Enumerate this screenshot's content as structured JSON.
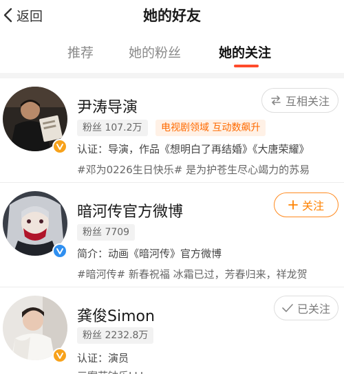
{
  "header": {
    "back_label": "返回",
    "title": "她的好友"
  },
  "tabs": [
    {
      "label": "推荐",
      "active": false
    },
    {
      "label": "她的粉丝",
      "active": false
    },
    {
      "label": "她的关注",
      "active": true
    }
  ],
  "colors": {
    "accent": "#ff4b2b",
    "follow_orange": "#ff8200",
    "tag_orange": "#ff6a00",
    "verify_orange": "#f7a21b",
    "verify_blue": "#2f8ff0"
  },
  "users": [
    {
      "name": "尹涛导演",
      "fans": "粉丝 107.2万",
      "tag": "电视剧领域 互动数飙升",
      "desc": "认证：导演，作品《想明白了再结婚》《大唐荣耀》",
      "sub": "#邓为0226生日快乐# 是为护苍生尽心竭力的苏易",
      "button": "互相关注",
      "button_icon": "mutual-follow-icon",
      "verify": "orange"
    },
    {
      "name": "暗河传官方微博",
      "fans": "粉丝 7709",
      "desc": "简介：动画《暗河传》官方微博",
      "sub": "#暗河传# 新春祝福 冰霜已过，芳春归来，祥龙贺",
      "button": "关注",
      "button_icon": "plus-icon",
      "verify": "blue"
    },
    {
      "name": "龚俊Simon",
      "fans": "粉丝 2232.8万",
      "desc": "认证：演员",
      "sub": "三案花钟乐LLL",
      "button": "已关注",
      "button_icon": "check-icon",
      "verify": "orange"
    }
  ]
}
